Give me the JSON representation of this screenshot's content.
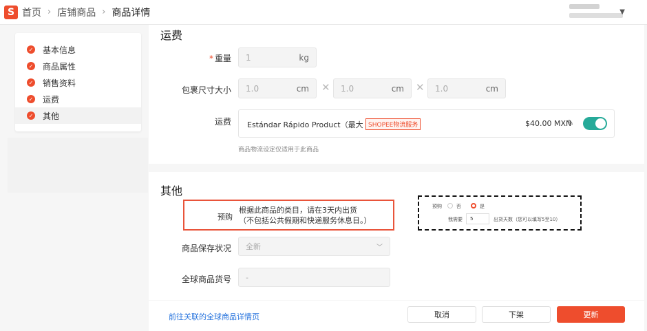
{
  "header": {
    "logo_letter": "S",
    "breadcrumb": [
      "首页",
      "店铺商品",
      "商品详情"
    ],
    "separator": "›"
  },
  "sidebar": {
    "items": [
      {
        "label": "基本信息",
        "done": true
      },
      {
        "label": "商品属性",
        "done": true
      },
      {
        "label": "销售资料",
        "done": true
      },
      {
        "label": "运费",
        "done": true
      },
      {
        "label": "其他",
        "done": true,
        "active": true
      }
    ]
  },
  "shipping": {
    "title": "运费",
    "weight_label": "重量",
    "weight_value": "1",
    "weight_unit": "kg",
    "size_label": "包裹尺寸大小",
    "dimensions": [
      {
        "value": "1.0",
        "unit": "cm"
      },
      {
        "value": "1.0",
        "unit": "cm"
      },
      {
        "value": "1.0",
        "unit": "cm"
      }
    ],
    "times": "✕",
    "fee_label": "运费",
    "channel_name": "Estándar Rápido Product（最大 15kg）",
    "channel_tag": "SHOPEE物流服务",
    "channel_price": "$40.00 MXN",
    "channel_enabled": true,
    "hint": "商品物流设定仅适用于此商品"
  },
  "other": {
    "title": "其他",
    "preorder_label": "预购",
    "preorder_text_line1": "根据此商品的类目，请在3天内出货",
    "preorder_text_line2": "（不包括公共假期和快递服务休息日。）",
    "preorder_mini": {
      "label": "预购",
      "no": "否",
      "yes": "是",
      "selected": "是",
      "need_label": "我需要",
      "days_value": "5",
      "days_hint": "出货天数（您可以填写5至10）"
    },
    "condition_label": "商品保存状况",
    "condition_value": "全新",
    "sku_label": "全球商品货号",
    "sku_placeholder": "-"
  },
  "footer": {
    "link": "前往关联的全球商品详情页",
    "cancel": "取消",
    "delist": "下架",
    "update": "更新"
  },
  "colors": {
    "brand": "#ee4d2d",
    "toggle_on": "#26aa99",
    "link": "#2673dd"
  }
}
